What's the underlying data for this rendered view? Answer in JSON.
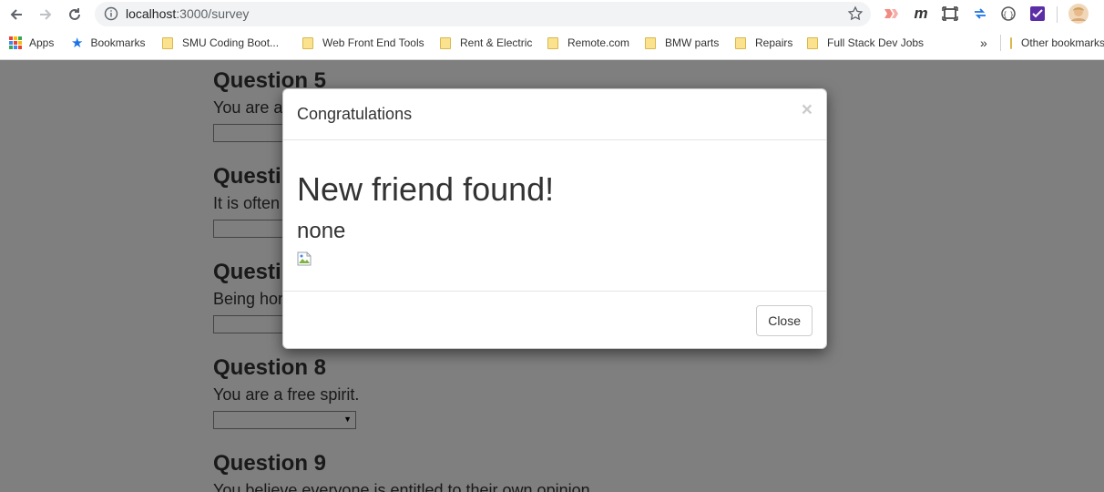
{
  "browser": {
    "url_host": "localhost",
    "url_path": ":3000/survey"
  },
  "bookmarks": [
    {
      "label": "Apps",
      "icon": "apps-grid-icon"
    },
    {
      "label": "Bookmarks",
      "icon": "star-icon"
    },
    {
      "label": "SMU Coding Boot...",
      "icon": "folder-icon"
    },
    {
      "label": "Web Front End Tools",
      "icon": "folder-icon"
    },
    {
      "label": "Rent & Electric",
      "icon": "folder-icon"
    },
    {
      "label": "Remote.com",
      "icon": "folder-icon"
    },
    {
      "label": "BMW parts",
      "icon": "folder-icon"
    },
    {
      "label": "Repairs",
      "icon": "folder-icon"
    },
    {
      "label": "Full Stack Dev Jobs",
      "icon": "folder-icon"
    },
    {
      "label": "Other bookmarks",
      "icon": "folder-icon"
    }
  ],
  "overflow_chevron": "»",
  "questions": [
    {
      "title": "Question 5",
      "text": "You are a"
    },
    {
      "title": "Questi",
      "text": "It is often"
    },
    {
      "title": "Questi",
      "text": "Being hor"
    },
    {
      "title": "Question 8",
      "text": "You are a free spirit."
    },
    {
      "title": "Question 9",
      "text": "You believe everyone is entitled to their own opinion."
    }
  ],
  "modal": {
    "title": "Congratulations",
    "close_x": "×",
    "heading": "New friend found!",
    "friend_name": "none",
    "close_button": "Close"
  },
  "colors": {
    "backdrop": "rgba(0,0,0,0.5)",
    "omnibox": "#f1f3f4",
    "folder": "#fbe28f"
  }
}
